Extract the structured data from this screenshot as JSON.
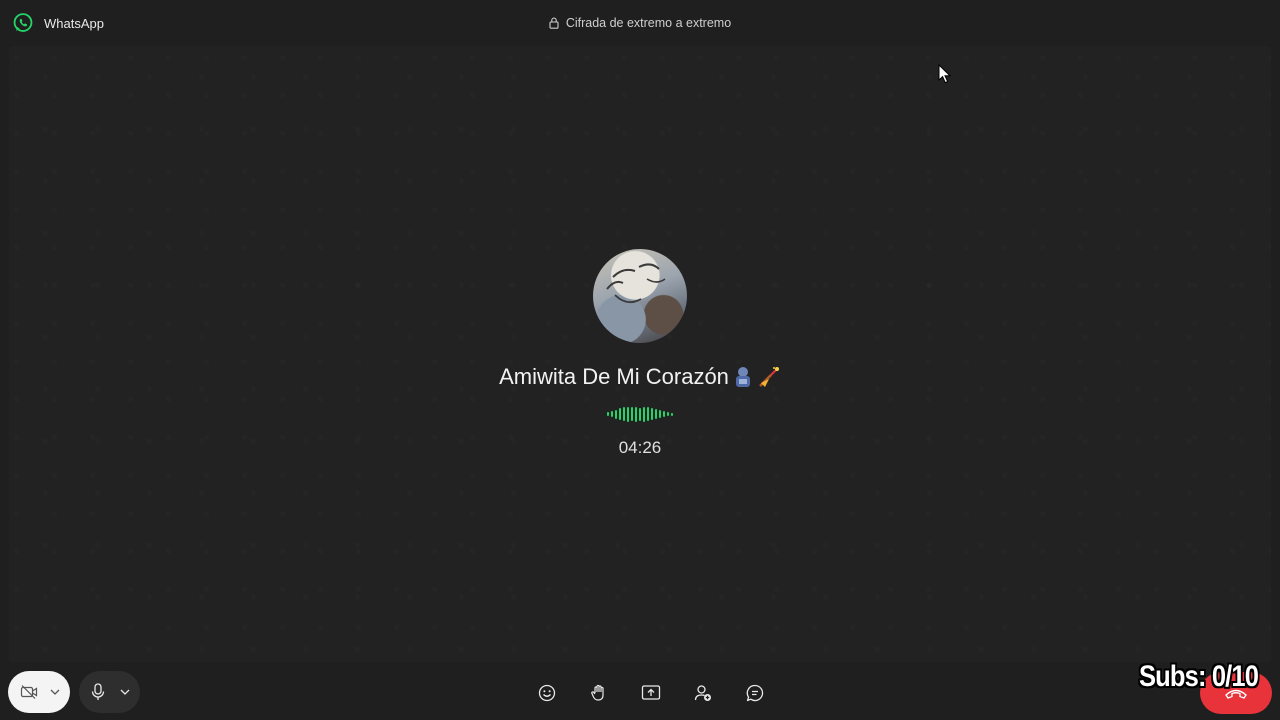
{
  "window": {
    "app_name": "WhatsApp",
    "encryption_label": "Cifrada de extremo a extremo"
  },
  "call": {
    "contact_name": "Amiwita De Mi Corazón",
    "contact_emojis": [
      "doll-emoji",
      "sparkler-emoji"
    ],
    "duration": "04:26",
    "status": "active"
  },
  "controls": {
    "video": {
      "icon": "camera-off-icon",
      "state": "off"
    },
    "mic": {
      "icon": "mic-icon",
      "state": "on"
    },
    "center": [
      {
        "name": "reactions-button",
        "icon": "emoji-icon"
      },
      {
        "name": "raise-hand-button",
        "icon": "hand-icon"
      },
      {
        "name": "share-screen-button",
        "icon": "share-screen-icon"
      },
      {
        "name": "add-participant-button",
        "icon": "add-person-icon"
      },
      {
        "name": "chat-button",
        "icon": "chat-icon"
      }
    ],
    "end_call": {
      "icon": "hangup-icon"
    }
  },
  "overlay": {
    "subs_text": "Subs: 0/10"
  },
  "colors": {
    "accent_green": "#25d366",
    "end_call_red": "#e8333b",
    "background": "#1f1f1f"
  }
}
